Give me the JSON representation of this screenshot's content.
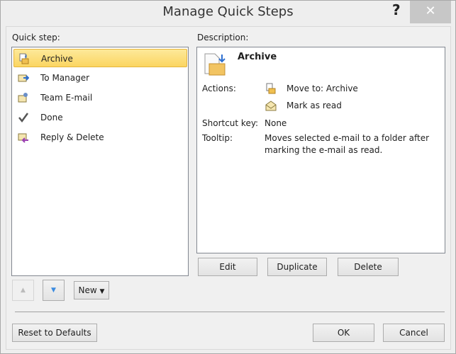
{
  "window": {
    "title": "Manage Quick Steps",
    "help": "?",
    "close": "✕"
  },
  "quick_step": {
    "label": "Quick step:",
    "items": [
      {
        "label": "Archive",
        "icon": "archive-icon",
        "selected": true
      },
      {
        "label": "To Manager",
        "icon": "forward-icon"
      },
      {
        "label": "Team E-mail",
        "icon": "team-email-icon"
      },
      {
        "label": "Done",
        "icon": "checkmark-icon"
      },
      {
        "label": "Reply & Delete",
        "icon": "reply-delete-icon"
      }
    ]
  },
  "description": {
    "label": "Description:",
    "name": "Archive",
    "actions_label": "Actions:",
    "actions": [
      "Move to: Archive",
      "Mark as read"
    ],
    "shortcut_label": "Shortcut key:",
    "shortcut_value": "None",
    "tooltip_label": "Tooltip:",
    "tooltip_value": [
      "Moves selected e-mail to a folder after",
      "marking the e-mail as read."
    ]
  },
  "buttons": {
    "edit": "Edit",
    "duplicate": "Duplicate",
    "delete": "Delete",
    "new": "New",
    "reset": "Reset to Defaults",
    "ok": "OK",
    "cancel": "Cancel"
  }
}
